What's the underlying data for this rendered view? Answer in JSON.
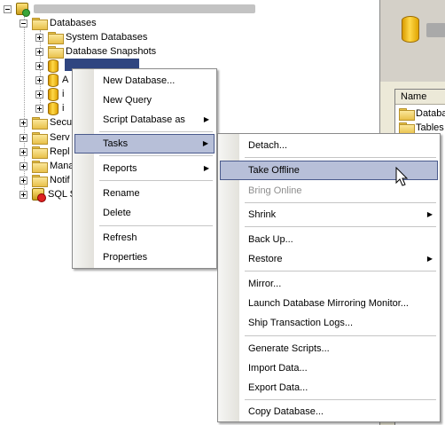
{
  "tree": {
    "items": [
      {
        "label": "Databases"
      },
      {
        "label": "System Databases"
      },
      {
        "label": "Database Snapshots"
      },
      {
        "label": "A"
      },
      {
        "label": "i"
      },
      {
        "label": "i"
      },
      {
        "label": "Secu"
      },
      {
        "label": "Serv"
      },
      {
        "label": "Repl"
      },
      {
        "label": "Mana"
      },
      {
        "label": "Notif"
      },
      {
        "label": "SQL S"
      }
    ]
  },
  "right_pane": {
    "column_header": "Name",
    "rows": [
      {
        "label": "Databa"
      },
      {
        "label": "Tables"
      }
    ]
  },
  "context_menu": {
    "items": [
      {
        "label": "New Database..."
      },
      {
        "label": "New Query"
      },
      {
        "label": "Script Database as"
      },
      {
        "label": "Tasks"
      },
      {
        "label": "Reports"
      },
      {
        "label": "Rename"
      },
      {
        "label": "Delete"
      },
      {
        "label": "Refresh"
      },
      {
        "label": "Properties"
      }
    ]
  },
  "tasks_submenu": {
    "items": [
      {
        "label": "Detach..."
      },
      {
        "label": "Take Offline"
      },
      {
        "label": "Bring Online"
      },
      {
        "label": "Shrink"
      },
      {
        "label": "Back Up..."
      },
      {
        "label": "Restore"
      },
      {
        "label": "Mirror..."
      },
      {
        "label": "Launch Database Mirroring Monitor..."
      },
      {
        "label": "Ship Transaction Logs..."
      },
      {
        "label": "Generate Scripts..."
      },
      {
        "label": "Import Data..."
      },
      {
        "label": "Export Data..."
      },
      {
        "label": "Copy Database..."
      }
    ]
  },
  "icons": {
    "submenu_arrow": "▶"
  },
  "colors": {
    "highlight": "#b7bfd8",
    "selection": "#0a246a",
    "folder": "#e8c04a"
  }
}
